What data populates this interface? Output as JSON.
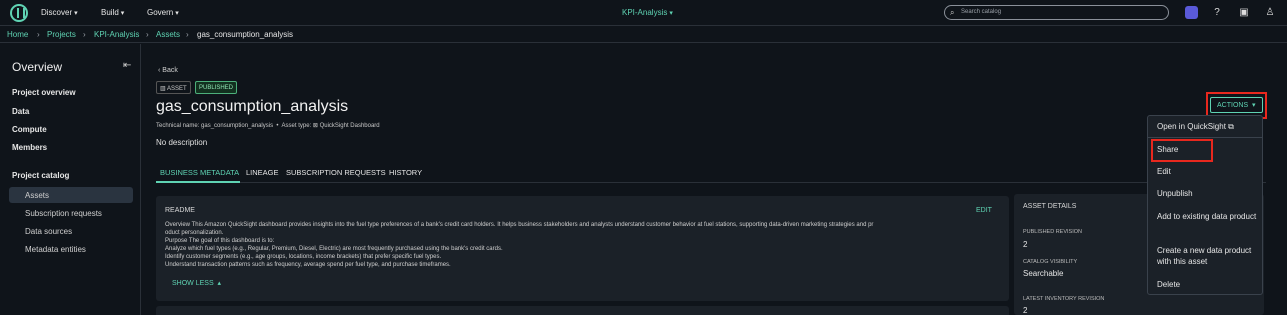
{
  "topnav": {
    "discover": "Discover",
    "build": "Build",
    "govern": "Govern",
    "project": "KPI-Analysis",
    "search_placeholder": "Search catalog"
  },
  "breadcrumb": [
    "Home",
    "Projects",
    "KPI-Analysis",
    "Assets",
    "gas_consumption_analysis"
  ],
  "sidebar": {
    "title": "Overview",
    "items": [
      "Project overview",
      "Data",
      "Compute",
      "Members"
    ],
    "catalog_heading": "Project catalog",
    "catalog_items": [
      "Assets",
      "Subscription requests",
      "Data sources",
      "Metadata entities"
    ]
  },
  "asset": {
    "back": "Back",
    "tag_asset": "ASSET",
    "tag_status": "PUBLISHED",
    "title": "gas_consumption_analysis",
    "technical_name": "Technical name: gas_consumption_analysis",
    "asset_type": "Asset type:",
    "asset_type_value": "QuickSight Dashboard",
    "description": "No description"
  },
  "tabs": [
    "BUSINESS METADATA",
    "LINEAGE",
    "SUBSCRIPTION REQUESTS",
    "HISTORY"
  ],
  "readme": {
    "heading": "README",
    "edit": "EDIT",
    "lines": [
      "Overview This Amazon QuickSight dashboard provides insights into the fuel type preferences of a bank's credit card holders. It helps business stakeholders and analysts understand customer behavior at fuel stations, supporting data-driven marketing strategies and pr",
      "oduct personalization.",
      "Purpose The goal of this dashboard is to:",
      "Analyze which fuel types (e.g., Regular, Premium, Diesel, Electric) are most frequently purchased using the bank's credit cards.",
      "Identify customer segments (e.g., age groups, locations, income brackets) that prefer specific fuel types.",
      "Understand transaction patterns such as frequency, average spend per fuel type, and purchase timeframes."
    ],
    "show_less": "SHOW LESS"
  },
  "asset_details": {
    "heading": "ASSET DETAILS",
    "published_revision_label": "PUBLISHED REVISION",
    "published_revision": "2",
    "catalog_visibility_label": "CATALOG VISIBILITY",
    "catalog_visibility": "Searchable",
    "latest_inventory_label": "LATEST INVENTORY REVISION",
    "latest_inventory": "2"
  },
  "actions": {
    "label": "ACTIONS",
    "menu": [
      "Open in QuickSight",
      "Share",
      "Edit",
      "Unpublish",
      "Add to existing data product",
      "Create a new data product with this asset",
      "Delete"
    ]
  },
  "colors": {
    "accent": "#5fd3b3",
    "highlight": "#e8281e",
    "background": "#0f141a"
  }
}
